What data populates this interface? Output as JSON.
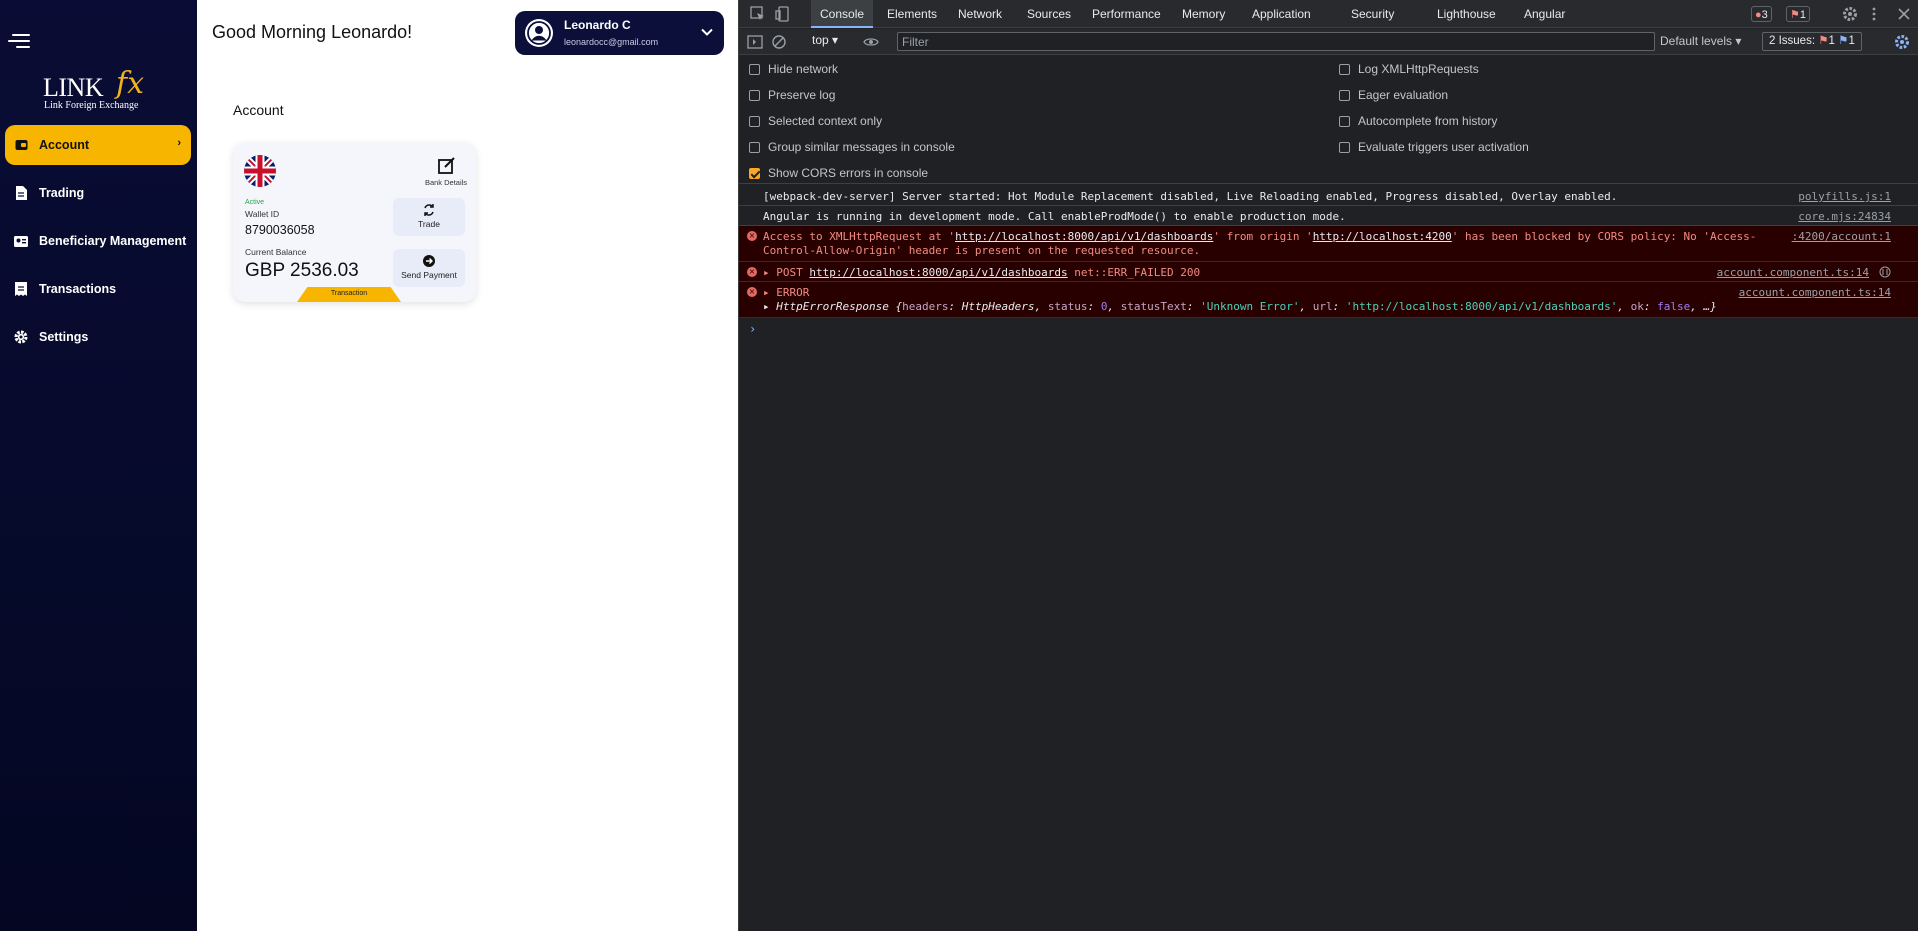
{
  "app": {
    "greeting": "Good Morning Leonardo!",
    "user": {
      "name": "Leonardo C",
      "email": "leonardocc@gmail.com"
    },
    "logo": {
      "main": "LINK",
      "accent": "fx",
      "tagline": "Link Foreign Exchange"
    },
    "nav": [
      {
        "label": "Account",
        "icon": "wallet-icon",
        "active": true
      },
      {
        "label": "Trading",
        "icon": "document-icon"
      },
      {
        "label": "Beneficiary Management",
        "icon": "id-card-icon"
      },
      {
        "label": "Transactions",
        "icon": "receipt-icon"
      },
      {
        "label": "Settings",
        "icon": "gear-icon"
      }
    ],
    "account": {
      "title": "Account",
      "card": {
        "currency_flag": "uk-flag-icon",
        "status": "Active",
        "wallet_label": "Wallet ID",
        "wallet_id": "8790036058",
        "balance_label": "Current Balance",
        "balance": "GBP 2536.03",
        "bank_details_label": "Bank Details",
        "trade_label": "Trade",
        "send_label": "Send Payment",
        "transaction_label": "Transaction"
      }
    }
  },
  "devtools": {
    "tabs": [
      "Console",
      "Elements",
      "Network",
      "Sources",
      "Performance",
      "Memory",
      "Application",
      "Security",
      "Lighthouse",
      "Angular"
    ],
    "error_count": "3",
    "issue_count": "1",
    "context": "top",
    "filter_placeholder": "Filter",
    "levels": "Default levels",
    "issues": {
      "label": "2 Issues:",
      "errors": "1",
      "infos": "1"
    },
    "settings_left": [
      {
        "label": "Hide network",
        "checked": false
      },
      {
        "label": "Preserve log",
        "checked": false
      },
      {
        "label": "Selected context only",
        "checked": false
      },
      {
        "label": "Group similar messages in console",
        "checked": false
      },
      {
        "label": "Show CORS errors in console",
        "checked": true
      }
    ],
    "settings_right": [
      {
        "label": "Log XMLHttpRequests",
        "checked": false
      },
      {
        "label": "Eager evaluation",
        "checked": false
      },
      {
        "label": "Autocomplete from history",
        "checked": false
      },
      {
        "label": "Evaluate triggers user activation",
        "checked": false
      }
    ],
    "messages": {
      "m1": {
        "text": "[webpack-dev-server] Server started: Hot Module Replacement disabled, Live Reloading enabled, Progress disabled, Overlay enabled.",
        "source": "polyfills.js:1"
      },
      "m2": {
        "text": "Angular is running in development mode. Call enableProdMode() to enable production mode.",
        "source": "core.mjs:24834"
      },
      "m3": {
        "pre": "Access to XMLHttpRequest at '",
        "url1": "http://localhost:8000/api/v1/dashboards",
        "mid": "' from origin '",
        "url2": "http://localhost:4200",
        "post": "' has been blocked by CORS policy: No 'Access-",
        "line2": "Control-Allow-Origin' header is present on the requested resource.",
        "source": ":4200/account:1"
      },
      "m4": {
        "method": "POST",
        "url": "http://localhost:8000/api/v1/dashboards",
        "status": "net::ERR_FAILED 200",
        "source": "account.component.ts:14"
      },
      "m5": {
        "label": "ERROR",
        "obj_name": "HttpErrorResponse",
        "headers_key": "headers",
        "headers_val": "HttpHeaders",
        "status_key": "status",
        "status_val": "0",
        "statusText_key": "statusText",
        "statusText_val": "'Unknown Error'",
        "url_key": "url",
        "url_val": "'http://localhost:8000/api/v1/dashboards'",
        "ok_key": "ok",
        "ok_val": "false",
        "tail": "…}",
        "source": "account.component.ts:14"
      }
    },
    "colors": {
      "accent": "#8ab4f8",
      "error_bg": "#290000",
      "error_text": "#f28b82",
      "checkbox": "#f9a825"
    }
  }
}
